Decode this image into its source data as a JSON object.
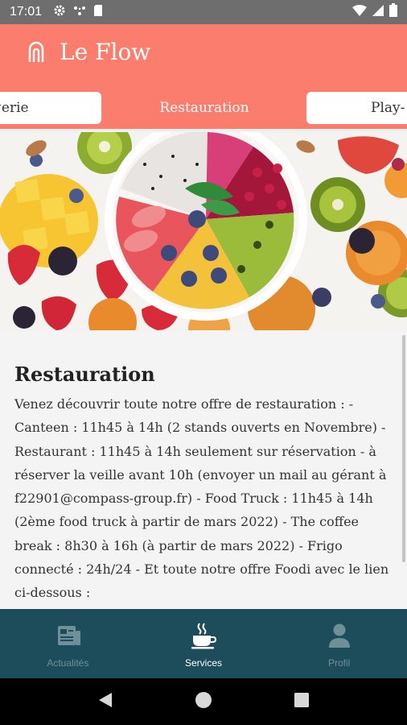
{
  "status_bar": {
    "time": "17:01"
  },
  "app": {
    "title": "Le Flow",
    "accent_color": "#fb7d6d",
    "nav_color": "#1d4d5b"
  },
  "tabs": [
    {
      "label": "Bergerie"
    },
    {
      "label": "Restauration",
      "active": true
    },
    {
      "label": "Play-"
    }
  ],
  "hero_image": {
    "icon": "food-photo"
  },
  "content": {
    "title": "Restauration",
    "body": "Venez découvrir toute notre offre de restauration : - Canteen : 11h45 à 14h (2 stands ouverts en Novembre) - Restaurant : 11h45 à 14h seulement sur réservation - à réserver la veille avant 10h (envoyer un mail au gérant à f22901@compass-group.fr) - Food Truck : 11h45 à 14h (2ème food truck à partir de mars 2022) - The coffee break : 8h30 à 16h (à partir de mars 2022) - Frigo connecté : 24h/24 - Et toute notre offre Foodi avec le lien ci-dessous :"
  },
  "bottom_nav": [
    {
      "label": "Actualités",
      "icon": "news-icon"
    },
    {
      "label": "Services",
      "icon": "coffee-cup-icon",
      "active": true
    },
    {
      "label": "Profil",
      "icon": "person-icon"
    }
  ]
}
